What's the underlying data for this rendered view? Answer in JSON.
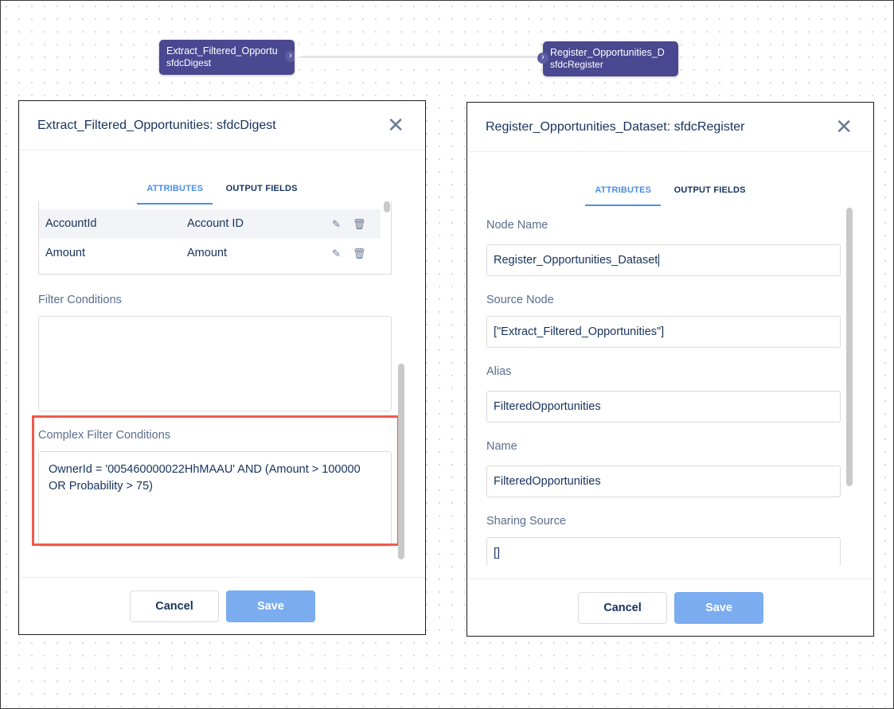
{
  "flow": {
    "node_left": {
      "title": "Extract_Filtered_Opportu",
      "type": "sfdcDigest"
    },
    "node_right": {
      "title": "Register_Opportunities_D",
      "type": "sfdcRegister"
    }
  },
  "left_dialog": {
    "title": "Extract_Filtered_Opportunities: sfdcDigest",
    "tabs": [
      "ATTRIBUTES",
      "OUTPUT FIELDS"
    ],
    "fields": [
      {
        "name": "AccountId",
        "label": "Account ID"
      },
      {
        "name": "Amount",
        "label": "Amount"
      }
    ],
    "filter_conditions_label": "Filter Conditions",
    "filter_conditions_value": "",
    "complex_filter_label": "Complex Filter Conditions",
    "complex_filter_line1": "OwnerId = '005460000022HhMAAU' AND (Amount > 100000",
    "complex_filter_line2": "OR Probability > 75)",
    "cancel": "Cancel",
    "save": "Save"
  },
  "right_dialog": {
    "title": "Register_Opportunities_Dataset: sfdcRegister",
    "tabs": [
      "ATTRIBUTES",
      "OUTPUT FIELDS"
    ],
    "node_name_label": "Node Name",
    "node_name_value": "Register_Opportunities_Dataset",
    "source_node_label": "Source Node",
    "source_node_value": "[\"Extract_Filtered_Opportunities\"]",
    "alias_label": "Alias",
    "alias_value": "FilteredOpportunities",
    "name_label": "Name",
    "name_value": "FilteredOpportunities",
    "sharing_source_label": "Sharing Source",
    "sharing_source_value": "[]",
    "cancel": "Cancel",
    "save": "Save"
  },
  "colors": {
    "node": "#4a4891",
    "accent": "#4b8ee8",
    "save_button": "#7aacef",
    "highlight": "#ef5a4c"
  },
  "icons": {
    "close": "close-icon",
    "edit": "pencil-icon",
    "delete": "trash-icon",
    "chevron": "chevron-right-icon"
  }
}
